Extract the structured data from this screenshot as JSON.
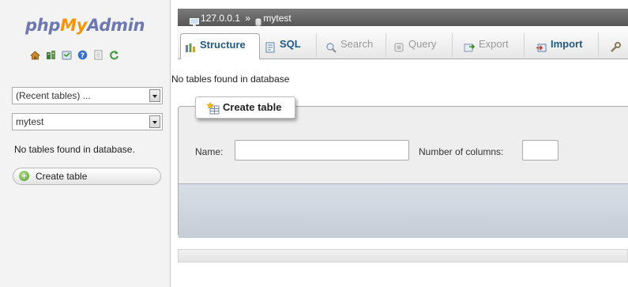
{
  "logo": {
    "part1": "php",
    "part2": "My",
    "part3": "Admin"
  },
  "nav_icons": [
    "home-icon",
    "database-icon",
    "query-window-icon",
    "help-icon",
    "documentation-icon",
    "reload-icon"
  ],
  "nav": {
    "recent_tables": "(Recent tables) ...",
    "database_select": "mytest",
    "empty_message": "No tables found in database.",
    "create_table_label": "Create table"
  },
  "breadcrumb": {
    "server": "127.0.0.1",
    "separator": "»",
    "database": "mytest"
  },
  "tabs": [
    {
      "label": "Structure",
      "icon": "structure-icon"
    },
    {
      "label": "SQL",
      "icon": "sql-icon"
    },
    {
      "label": "Search",
      "icon": "search-icon"
    },
    {
      "label": "Query",
      "icon": "query-icon"
    },
    {
      "label": "Export",
      "icon": "export-icon"
    },
    {
      "label": "Import",
      "icon": "import-icon"
    },
    {
      "label": "",
      "icon": "operations-icon"
    }
  ],
  "main": {
    "message": "No tables found in database",
    "create_table": {
      "legend": "Create table",
      "name_label": "Name:",
      "name_value": "",
      "columns_label": "Number of columns:",
      "columns_value": ""
    }
  },
  "colors": {
    "logo_blue": "#6c78af",
    "logo_orange": "#f89406",
    "breadcrumb_bg": "#666666",
    "tab_text": "#235a81"
  }
}
